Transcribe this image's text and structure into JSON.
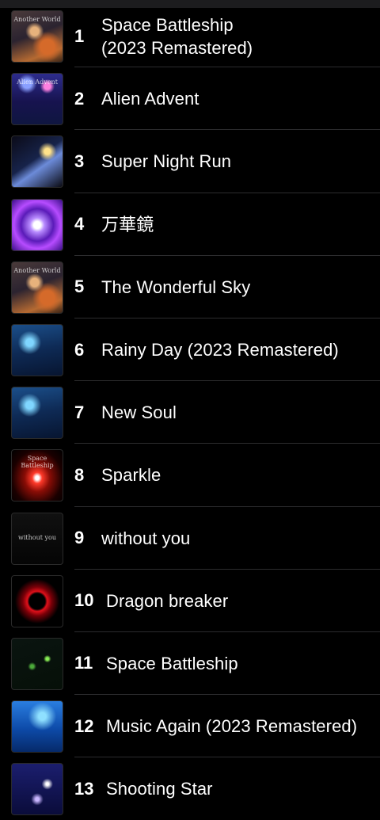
{
  "tracks": [
    {
      "number": "1",
      "title": "Space Battleship\n(2023 Remastered)",
      "cover_text": "Another World"
    },
    {
      "number": "2",
      "title": "Alien Advent",
      "cover_text": "Alien Advent"
    },
    {
      "number": "3",
      "title": "Super Night Run",
      "cover_text": ""
    },
    {
      "number": "4",
      "title": "万華鏡",
      "cover_text": ""
    },
    {
      "number": "5",
      "title": "The Wonderful Sky",
      "cover_text": "Another World"
    },
    {
      "number": "6",
      "title": "Rainy Day (2023 Remastered)",
      "cover_text": ""
    },
    {
      "number": "7",
      "title": "New Soul",
      "cover_text": ""
    },
    {
      "number": "8",
      "title": "Sparkle",
      "cover_text": "Space Battleship"
    },
    {
      "number": "9",
      "title": "without you",
      "cover_text": "without you"
    },
    {
      "number": "10",
      "title": "Dragon breaker",
      "cover_text": ""
    },
    {
      "number": "11",
      "title": "Space Battleship",
      "cover_text": ""
    },
    {
      "number": "12",
      "title": "Music Again (2023 Remastered)",
      "cover_text": ""
    },
    {
      "number": "13",
      "title": "Shooting Star",
      "cover_text": ""
    }
  ]
}
